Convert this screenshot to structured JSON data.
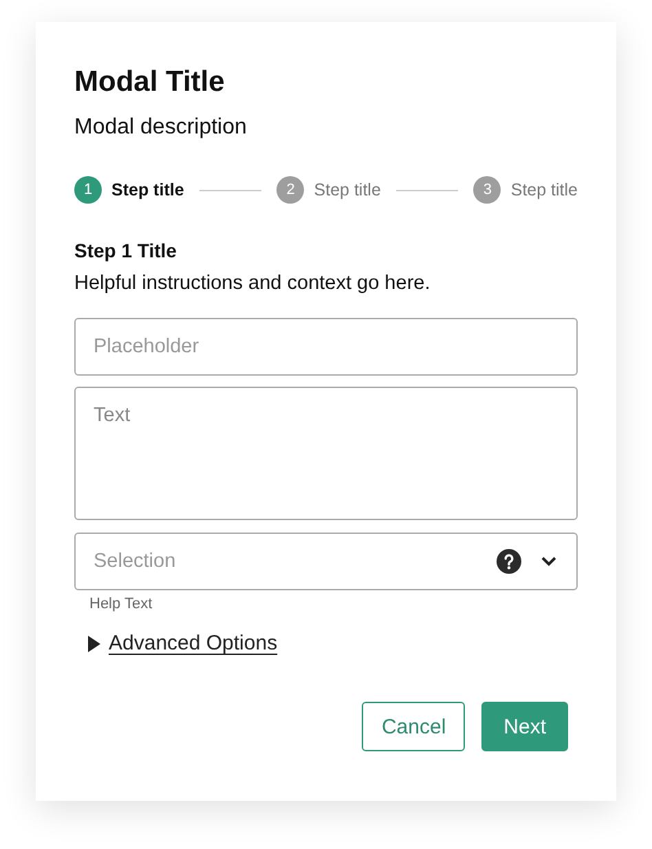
{
  "modal": {
    "title": "Modal Title",
    "description": "Modal description"
  },
  "steps": [
    {
      "number": "1",
      "label": "Step title",
      "selected": true
    },
    {
      "number": "2",
      "label": "Step title",
      "selected": false
    },
    {
      "number": "3",
      "label": "Step title",
      "selected": false
    }
  ],
  "section": {
    "title": "Step 1 Title",
    "instructions": "Helpful instructions and context go here."
  },
  "input": {
    "placeholder": "Placeholder"
  },
  "textarea": {
    "placeholder": "Text"
  },
  "select": {
    "placeholder": "Selection",
    "help_text": "Help Text"
  },
  "advanced": {
    "label": "Advanced Options",
    "expanded": false
  },
  "buttons": [
    {
      "label": "Cancel",
      "kind": "secondary"
    },
    {
      "label": "Next",
      "kind": "primary"
    }
  ]
}
